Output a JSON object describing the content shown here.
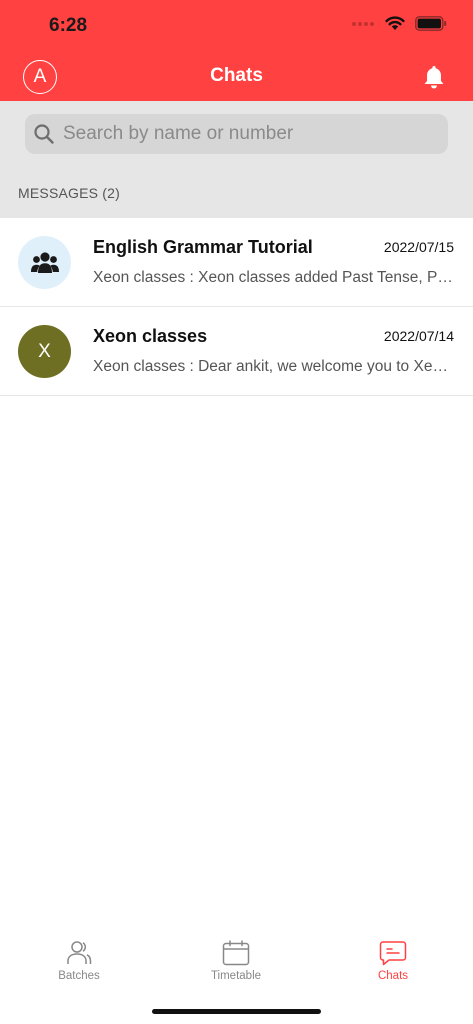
{
  "status_bar": {
    "time": "6:28"
  },
  "header": {
    "avatar_letter": "A",
    "title": "Chats",
    "accent_color": "#ff4141"
  },
  "search": {
    "placeholder": "Search by name or number"
  },
  "messages_section": {
    "label": "MESSAGES (2)"
  },
  "chats": [
    {
      "avatar_type": "group-icon",
      "avatar_bg": "#dff0fb",
      "name": "English Grammar Tutorial",
      "date": "2022/07/15",
      "preview": "Xeon classes : Xeon classes added Past Tense, Present Tense"
    },
    {
      "avatar_type": "letter",
      "avatar_letter": "X",
      "avatar_bg": "#6e6f22",
      "name": "Xeon classes",
      "date": "2022/07/14",
      "preview": "Xeon classes : Dear ankit, we welcome you to Xeon classes"
    }
  ],
  "tab_bar": {
    "tabs": [
      {
        "label": "Batches",
        "icon": "person-icon",
        "active": false
      },
      {
        "label": "Timetable",
        "icon": "calendar-icon",
        "active": false
      },
      {
        "label": "Chats",
        "icon": "chat-icon",
        "active": true
      }
    ]
  }
}
